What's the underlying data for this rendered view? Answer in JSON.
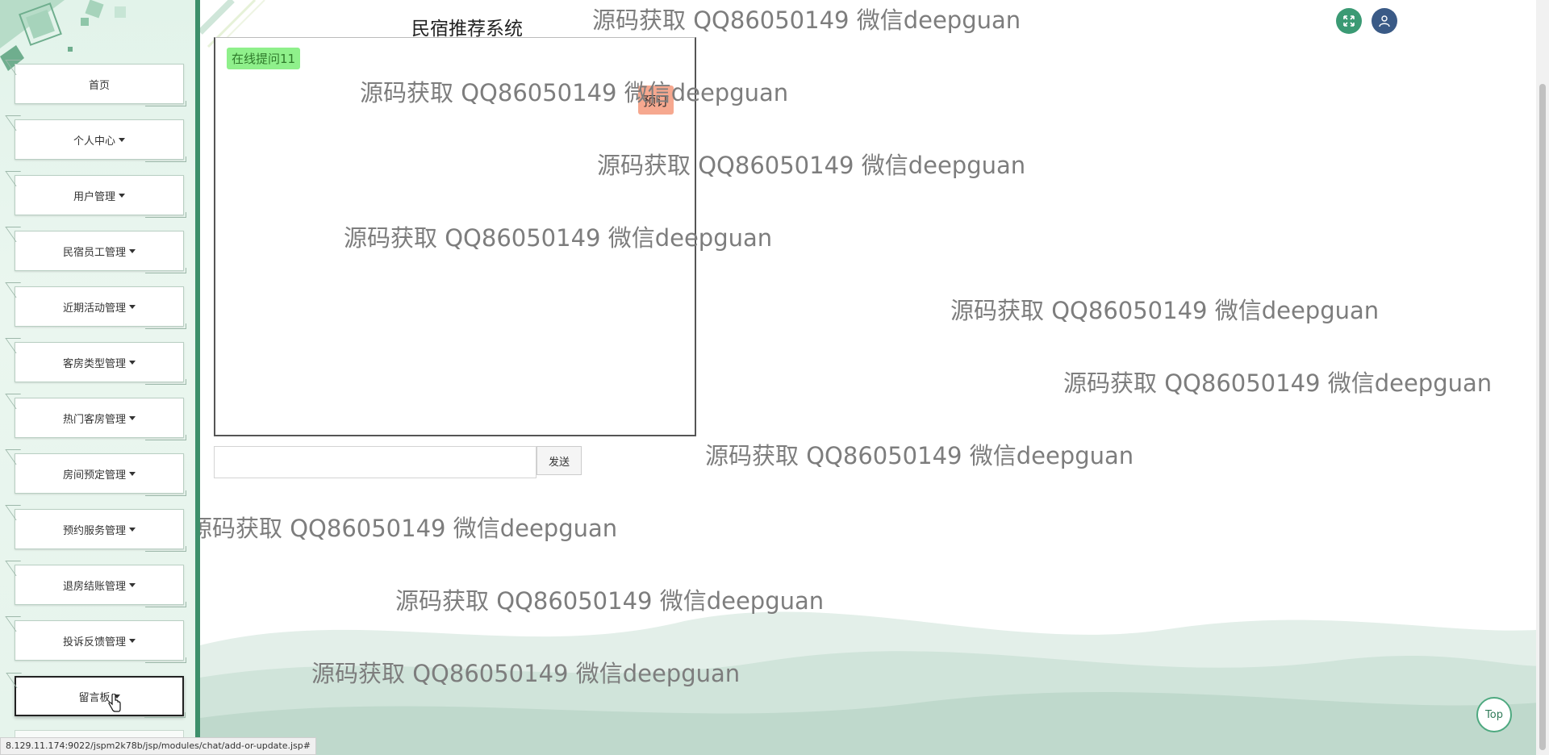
{
  "header": {
    "system_title": "民宿推荐系统"
  },
  "sidebar": {
    "items": [
      {
        "label": "首页",
        "has_caret": false
      },
      {
        "label": "个人中心",
        "has_caret": true
      },
      {
        "label": "用户管理",
        "has_caret": true
      },
      {
        "label": "民宿员工管理",
        "has_caret": true
      },
      {
        "label": "近期活动管理",
        "has_caret": true
      },
      {
        "label": "客房类型管理",
        "has_caret": true
      },
      {
        "label": "热门客房管理",
        "has_caret": true
      },
      {
        "label": "房间预定管理",
        "has_caret": true
      },
      {
        "label": "预约服务管理",
        "has_caret": true
      },
      {
        "label": "退房结账管理",
        "has_caret": true
      },
      {
        "label": "投诉反馈管理",
        "has_caret": true
      },
      {
        "label": "留言板",
        "has_caret": true
      }
    ]
  },
  "chat": {
    "question_message": "在线提问11",
    "reply_message": "预订",
    "input_value": "",
    "send_label": "发送"
  },
  "watermark_text": "源码获取 QQ86050149 微信deepguan",
  "top_button_label": "Top",
  "status_url": "8.129.11.174:9022/jspm2k78b/jsp/modules/chat/add-or-update.jsp#",
  "colors": {
    "sidebar_border": "#3d8f6b",
    "question_bg": "#8ff08b",
    "reply_bg": "#f6a88f",
    "fullscreen_btn": "#3b9a74",
    "user_btn": "#3a5a86"
  },
  "icons": {
    "fullscreen": "expand-icon",
    "user": "user-icon",
    "cursor": "hand-pointer-icon"
  }
}
